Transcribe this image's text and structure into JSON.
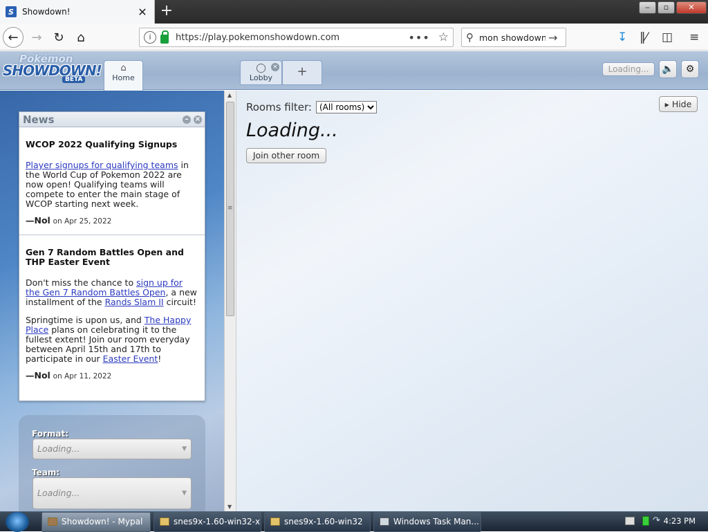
{
  "browser": {
    "tab_title": "Showdown!",
    "favicon_letter": "S",
    "new_tab": "+",
    "close": "✕",
    "window_min": "‒",
    "window_max": "▫",
    "window_close": "✕",
    "url": "https://play.pokemonshowdown.com",
    "search_value": "mon showdown",
    "page_actions": "•••"
  },
  "header": {
    "logo_top": "Pokémon",
    "logo_main": "SHOWDOWN!",
    "logo_badge": "BETA",
    "home_tab": "Home",
    "lobby_tab": "Lobby",
    "add_tab": "+",
    "loading_button": "Loading..."
  },
  "news": {
    "title": "News",
    "entries": [
      {
        "title": "WCOP 2022 Qualifying Signups",
        "link1": "Player signups for qualifying teams",
        "text1": " in the World Cup of Pokemon 2022 are now open! Qualifying teams will compete to enter the main stage of WCOP starting next week.",
        "author": "—Nol",
        "date": "on Apr 25, 2022"
      },
      {
        "title": "Gen 7 Random Battles Open and THP Easter Event",
        "p1_text1": "Don't miss the chance to ",
        "p1_link1": "sign up for the Gen 7 Random Battles Open",
        "p1_text2": ", a new installment of the ",
        "p1_link2": "Rands Slam II",
        "p1_text3": " circuit!",
        "p2_text1": "Springtime is upon us, and ",
        "p2_link1": "The Happy Place",
        "p2_text2": " plans on celebrating it to the fullest extent! Join our room everyday between April 15th and 17th to participate in our ",
        "p2_link2": "Easter Event",
        "p2_text3": "!",
        "author": "—Nol",
        "date": "on Apr 11, 2022"
      }
    ]
  },
  "format_panel": {
    "format_label": "Format:",
    "format_value": "Loading...",
    "team_label": "Team:",
    "team_value": "Loading..."
  },
  "main": {
    "filter_label": "Rooms filter:",
    "filter_value": "(All rooms)",
    "hide_button": "Hide",
    "loading_title": "Loading...",
    "join_button": "Join other room"
  },
  "taskbar": {
    "tasks": [
      "Showdown! - Mypal",
      "snes9x-1.60-win32-x...",
      "snes9x-1.60-win32",
      "Windows Task Man..."
    ],
    "clock": "4:23 PM"
  }
}
